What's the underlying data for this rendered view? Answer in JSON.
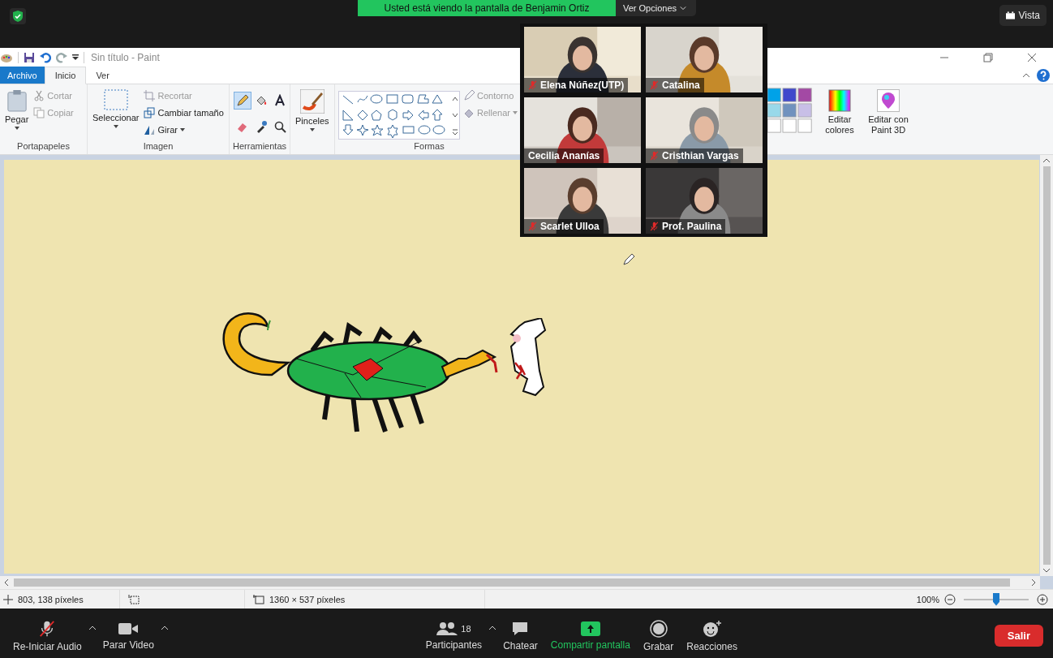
{
  "meeting": {
    "share_banner": "Usted está viendo la pantalla de Benjamin Ortiz",
    "view_options": "Ver Opciones",
    "view_button": "Vista"
  },
  "paint": {
    "title": "Sin título - Paint",
    "tabs": [
      {
        "label": "Archivo",
        "selected": false,
        "kind": "file"
      },
      {
        "label": "Inicio",
        "selected": true,
        "kind": "tab"
      },
      {
        "label": "Ver",
        "selected": false,
        "kind": "tab"
      }
    ],
    "clipboard": {
      "label": "Portapapeles",
      "paste": "Pegar",
      "cut": {
        "label": "Cortar",
        "disabled": true
      },
      "copy": {
        "label": "Copiar",
        "disabled": true
      }
    },
    "image": {
      "label": "Imagen",
      "select": "Seleccionar",
      "crop": {
        "label": "Recortar",
        "disabled": true
      },
      "resize": {
        "label": "Cambiar tamaño",
        "disabled": false
      },
      "rotate": {
        "label": "Girar",
        "disabled": false
      }
    },
    "tools": {
      "label": "Herramientas",
      "items": [
        {
          "selected": true
        },
        {
          "selected": false
        },
        {
          "selected": false
        },
        {
          "selected": false
        },
        {
          "selected": false
        },
        {
          "selected": false
        }
      ]
    },
    "brushes": "Pinceles",
    "shapes": {
      "label": "Formas",
      "outline": {
        "label": "Contorno",
        "disabled": true
      },
      "fill": {
        "label": "Rellenar",
        "disabled": true
      }
    },
    "edit_colors": "Editar colores",
    "paint3d": "Editar con Paint 3D",
    "status": {
      "cursor": "803, 138 píxeles",
      "size": "1360 × 537 píxeles",
      "zoom": "100%",
      "level": 0.5
    }
  },
  "participants": [
    {
      "name": "Elena Núñez(UTP)",
      "muted": true
    },
    {
      "name": "Catalina",
      "muted": true
    },
    {
      "name": "Cecilia Ananías",
      "muted": false
    },
    {
      "name": "Cristhian Vargas",
      "muted": true
    },
    {
      "name": "Scarlet Ulloa",
      "muted": true
    },
    {
      "name": "Prof. Paulina",
      "muted": true
    }
  ],
  "toolbar": {
    "audio": {
      "label": "Re-Iniciar Audio",
      "muted": true
    },
    "video": "Parar Video",
    "participants": "Participantes",
    "count": "18",
    "chat": "Chatear",
    "share": "Compartir pantalla",
    "record": "Grabar",
    "reactions": "Reacciones",
    "leave": "Salir"
  }
}
